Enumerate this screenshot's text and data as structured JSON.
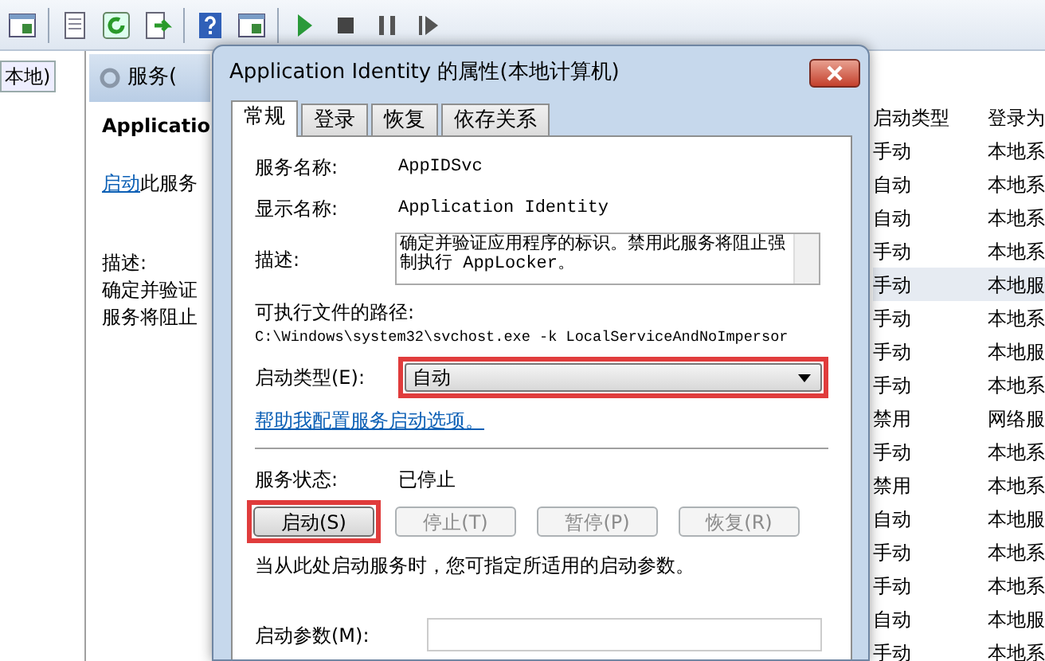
{
  "toolbar": {
    "buttons": [
      {
        "kind": "view"
      },
      {
        "kind": "sep"
      },
      {
        "kind": "doc"
      },
      {
        "kind": "refresh"
      },
      {
        "kind": "export"
      },
      {
        "kind": "sep"
      },
      {
        "kind": "help"
      },
      {
        "kind": "view"
      },
      {
        "kind": "sep"
      },
      {
        "kind": "play"
      },
      {
        "kind": "stop"
      },
      {
        "kind": "pause"
      },
      {
        "kind": "resume"
      }
    ]
  },
  "tree": {
    "items": [
      {
        "label": "本地)",
        "selected": true
      }
    ]
  },
  "services_pane": {
    "header": "服务(",
    "service_name": "Applicatio",
    "start_link": "启动",
    "start_text": "此服务",
    "description_label": "描述:",
    "description_lines": [
      "确定并验证",
      "服务将阻止"
    ]
  },
  "service_list": {
    "columns": [
      "启动类型",
      "登录为"
    ],
    "rows": [
      {
        "cells": [
          "手动",
          "本地系"
        ],
        "selected": false
      },
      {
        "cells": [
          "自动",
          "本地系"
        ],
        "selected": false
      },
      {
        "cells": [
          "自动",
          "本地系"
        ],
        "selected": false
      },
      {
        "cells": [
          "手动",
          "本地系"
        ],
        "selected": false
      },
      {
        "cells": [
          "手动",
          "本地服"
        ],
        "selected": true
      },
      {
        "cells": [
          "手动",
          "本地系"
        ],
        "selected": false
      },
      {
        "cells": [
          "手动",
          "本地服"
        ],
        "selected": false
      },
      {
        "cells": [
          "手动",
          "本地系"
        ],
        "selected": false
      },
      {
        "cells": [
          "禁用",
          "网络服"
        ],
        "selected": false
      },
      {
        "cells": [
          "手动",
          "本地系"
        ],
        "selected": false
      },
      {
        "cells": [
          "禁用",
          "本地系"
        ],
        "selected": false
      },
      {
        "cells": [
          "自动",
          "本地服"
        ],
        "selected": false
      },
      {
        "cells": [
          "手动",
          "本地系"
        ],
        "selected": false
      },
      {
        "cells": [
          "手动",
          "本地系"
        ],
        "selected": false
      },
      {
        "cells": [
          "自动",
          "本地服"
        ],
        "selected": false
      },
      {
        "cells": [
          "手动",
          "本地系"
        ],
        "selected": false
      }
    ]
  },
  "dialog": {
    "title": "Application Identity 的属性(本地计算机)",
    "tabs": [
      {
        "label": "常规",
        "selected": true
      },
      {
        "label": "登录",
        "selected": false
      },
      {
        "label": "恢复",
        "selected": false
      },
      {
        "label": "依存关系",
        "selected": false
      }
    ],
    "service_name": {
      "label": "服务名称:",
      "value": "AppIDSvc"
    },
    "display_name": {
      "label": "显示名称:",
      "value": "Application Identity"
    },
    "description": {
      "label": "描述:",
      "value": "确定并验证应用程序的标识。禁用此服务将阻止强制执行 AppLocker。"
    },
    "path": {
      "label": "可执行文件的路径:",
      "value": "C:\\Windows\\system32\\svchost.exe -k LocalServiceAndNoImpersor"
    },
    "startup_type": {
      "label": "启动类型(E):",
      "value": "自动",
      "highlighted": true
    },
    "help_link": "帮助我配置服务启动选项。",
    "status": {
      "label": "服务状态:",
      "value": "已停止"
    },
    "buttons": [
      {
        "label": "启动(S)",
        "disabled": false,
        "highlighted": true
      },
      {
        "label": "停止(T)",
        "disabled": true,
        "highlighted": false
      },
      {
        "label": "暂停(P)",
        "disabled": true,
        "highlighted": false
      },
      {
        "label": "恢复(R)",
        "disabled": true,
        "highlighted": false
      }
    ],
    "note": "当从此处启动服务时，您可指定所适用的启动参数。",
    "start_params": {
      "label": "启动参数(M):"
    }
  }
}
